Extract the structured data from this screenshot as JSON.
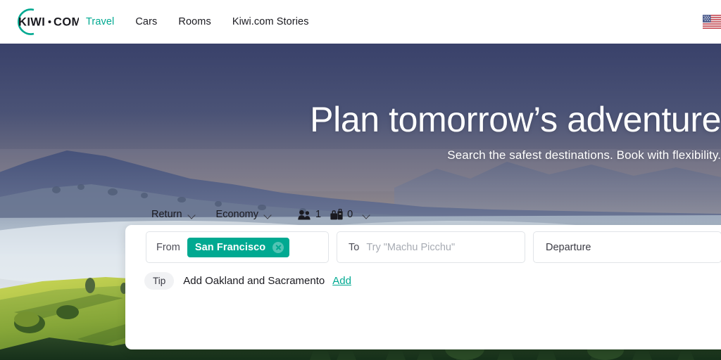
{
  "header": {
    "logo": {
      "name": "kiwi-com-logo",
      "text_primary": "KIWI",
      "text_dot": "·",
      "text_secondary": "COM"
    },
    "nav": [
      {
        "id": "travel",
        "label": "Travel",
        "active": true
      },
      {
        "id": "cars",
        "label": "Cars",
        "active": false
      },
      {
        "id": "rooms",
        "label": "Rooms",
        "active": false
      },
      {
        "id": "stories",
        "label": "Kiwi.com Stories",
        "active": false
      }
    ],
    "locale_flag": "us-flag-icon",
    "accent_color": "#00a991",
    "nav_text_color": "#1a1a20"
  },
  "hero": {
    "title": "Plan tomorrow’s adventure",
    "subtitle": "Search the safest destinations. Book with flexibility.",
    "background": "mountain-landscape-photo",
    "sky_top_color": "#3b4467",
    "sky_bottom_color": "#c9b49d",
    "mist_color": "#cfd8e0",
    "grass_color": "#7fa033"
  },
  "search": {
    "trip_type": {
      "label": "Return",
      "chevron": "chevron-down-icon"
    },
    "cabin_class": {
      "label": "Economy",
      "chevron": "chevron-down-icon"
    },
    "passengers": {
      "icon": "passengers-icon",
      "count": "1"
    },
    "bags": {
      "icon": "bag-icon",
      "count": "0"
    },
    "pax_chevron": "chevron-down-icon",
    "from": {
      "label": "From",
      "tag": "San Francisco",
      "tag_remove_icon": "close-circle-icon",
      "tag_color": "#00a991"
    },
    "to": {
      "label": "To",
      "placeholder": "Try \"Machu Picchu\""
    },
    "departure": {
      "label": "Departure"
    },
    "tip": {
      "badge": "Tip",
      "text": "Add Oakland and Sacramento",
      "action": "Add"
    }
  }
}
